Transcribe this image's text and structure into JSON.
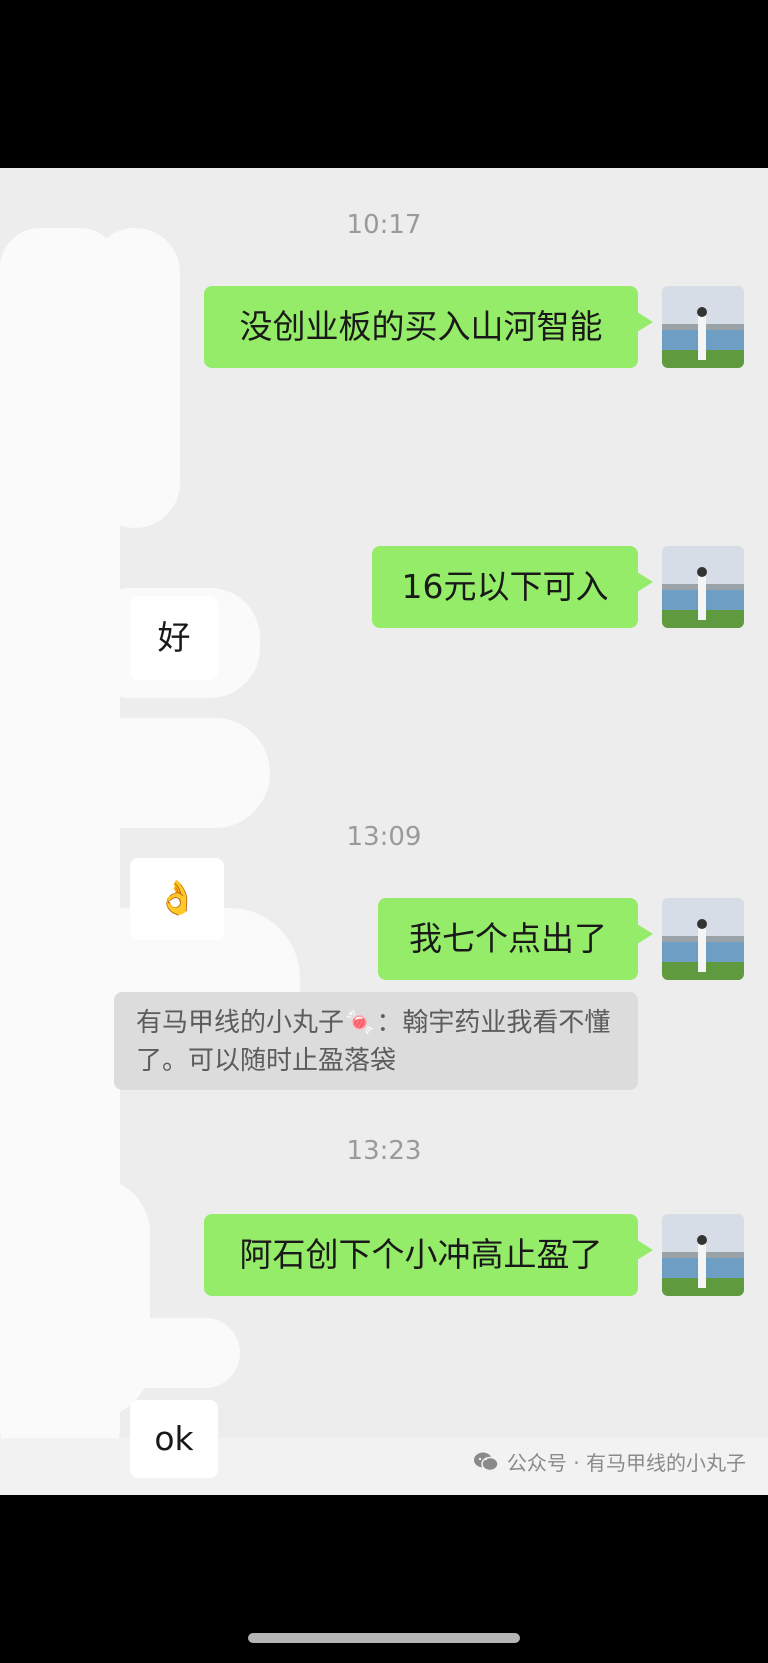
{
  "timestamps": [
    "10:17",
    "13:09",
    "13:23"
  ],
  "messages": {
    "m1": "没创业板的买入山河智能",
    "m2": "好",
    "m3": "16元以下可入",
    "m4": "👌",
    "m5": "我七个点出了",
    "m6": "阿石创下个小冲高止盈了",
    "m7": "ok"
  },
  "quote": {
    "line1": "有马甲线的小丸子🍬：翰宇药业我看不懂",
    "line2": "了。可以随时止盈落袋"
  },
  "watermark": {
    "text": "公众号 · 有马甲线的小丸子",
    "icon": "wechat-icon"
  },
  "colors": {
    "outgoing_bubble": "#95ec69",
    "incoming_bubble": "#ffffff",
    "chat_background": "#ededed"
  }
}
